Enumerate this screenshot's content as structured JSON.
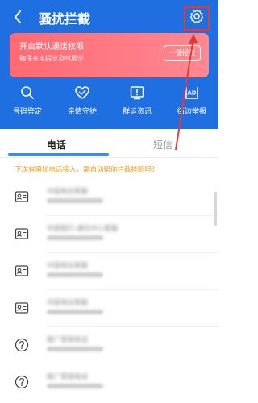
{
  "header": {
    "title": "骚扰拦截",
    "back_icon": "chevron-left-icon",
    "settings_icon": "gear-icon"
  },
  "banner": {
    "title": "开启默认通话权限",
    "subtitle": "确保来电提示及时展示",
    "button_label": "一键授权"
  },
  "quick_actions": [
    {
      "label": "号码鉴定",
      "icon": "search-icon"
    },
    {
      "label": "亲情守护",
      "icon": "heart-shield-icon"
    },
    {
      "label": "群运资讯",
      "icon": "alert-card-icon"
    },
    {
      "label": "街边举报",
      "icon": "ad-report-icon"
    }
  ],
  "tabs": [
    {
      "label": "电话",
      "selected": true
    },
    {
      "label": "短信",
      "selected": false
    }
  ],
  "prompt": "下次有骚扰电话接入，需自动帮你拦截挂断吗？",
  "call_list": [
    {
      "name": "中国电信客服",
      "icon": "contact-card-icon"
    },
    {
      "name": "中国银行-通讯中心客服",
      "icon": "contact-card-icon"
    },
    {
      "name": "中国电信客服",
      "icon": "contact-card-icon"
    },
    {
      "name": "中国电信客服",
      "icon": "contact-card-icon"
    },
    {
      "name": "推广营销电话",
      "icon": "question-circle-icon"
    },
    {
      "name": "推广营销电话",
      "icon": "question-circle-icon"
    }
  ],
  "colors": {
    "header_blue": "#1f6fe0",
    "banner_red": "#ff6a73",
    "tab_accent": "#2e8fff",
    "prompt_orange": "#f59a1b",
    "annotation_red": "#e53935"
  }
}
